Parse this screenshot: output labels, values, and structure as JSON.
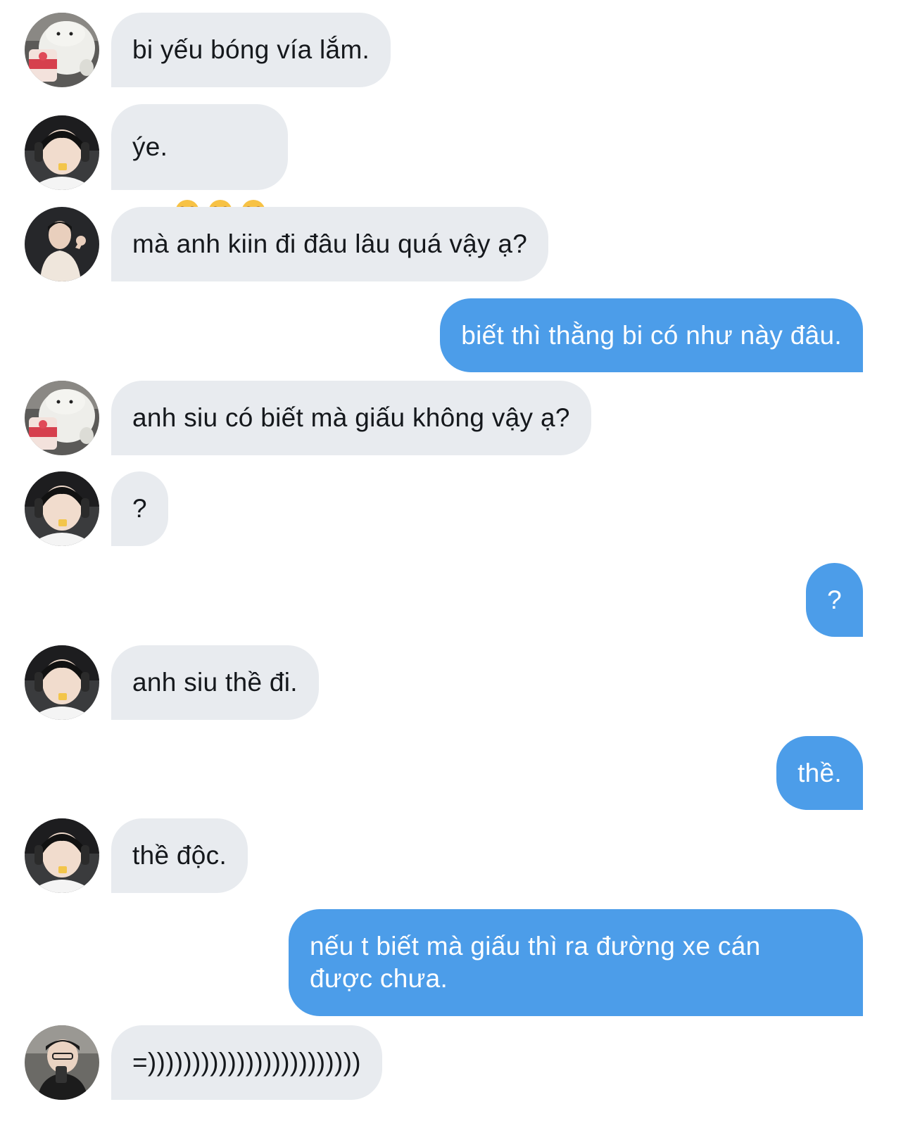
{
  "conversation": {
    "messages": [
      {
        "side": "in",
        "avatar": "polar-bear-avatar",
        "text": "bi yếu bóng vía lắm."
      },
      {
        "side": "in",
        "avatar": "boy-headset-avatar",
        "text": "ýe.",
        "emoji": [
          "loudly-crying-face",
          "loudly-crying-face",
          "loudly-crying-face"
        ]
      },
      {
        "side": "in",
        "avatar": "boy-waving-avatar",
        "text": "mà anh kiin đi đâu lâu quá vậy ạ?"
      },
      {
        "side": "out",
        "text": "biết thì thằng bi có như này đâu."
      },
      {
        "side": "in",
        "avatar": "polar-bear-avatar",
        "text": "anh siu có biết mà giấu không vậy ạ?"
      },
      {
        "side": "in",
        "avatar": "boy-headset-avatar",
        "text": "?"
      },
      {
        "side": "out",
        "text": "?"
      },
      {
        "side": "in",
        "avatar": "boy-headset-avatar",
        "text": "anh siu thề đi."
      },
      {
        "side": "out",
        "text": "thề."
      },
      {
        "side": "in",
        "avatar": "boy-headset-avatar",
        "text": "thề độc."
      },
      {
        "side": "out",
        "text": "nếu t biết mà giấu thì ra đường xe cán\nđược chưa."
      },
      {
        "side": "in",
        "avatar": "boy-phone-avatar",
        "text": "=))))))))))))))))))))))))"
      }
    ]
  },
  "colors": {
    "incoming_bubble": "#e8ebef",
    "incoming_text": "#15181c",
    "outgoing_bubble": "#4c9de9",
    "outgoing_text": "#ffffff",
    "background": "#ffffff"
  }
}
